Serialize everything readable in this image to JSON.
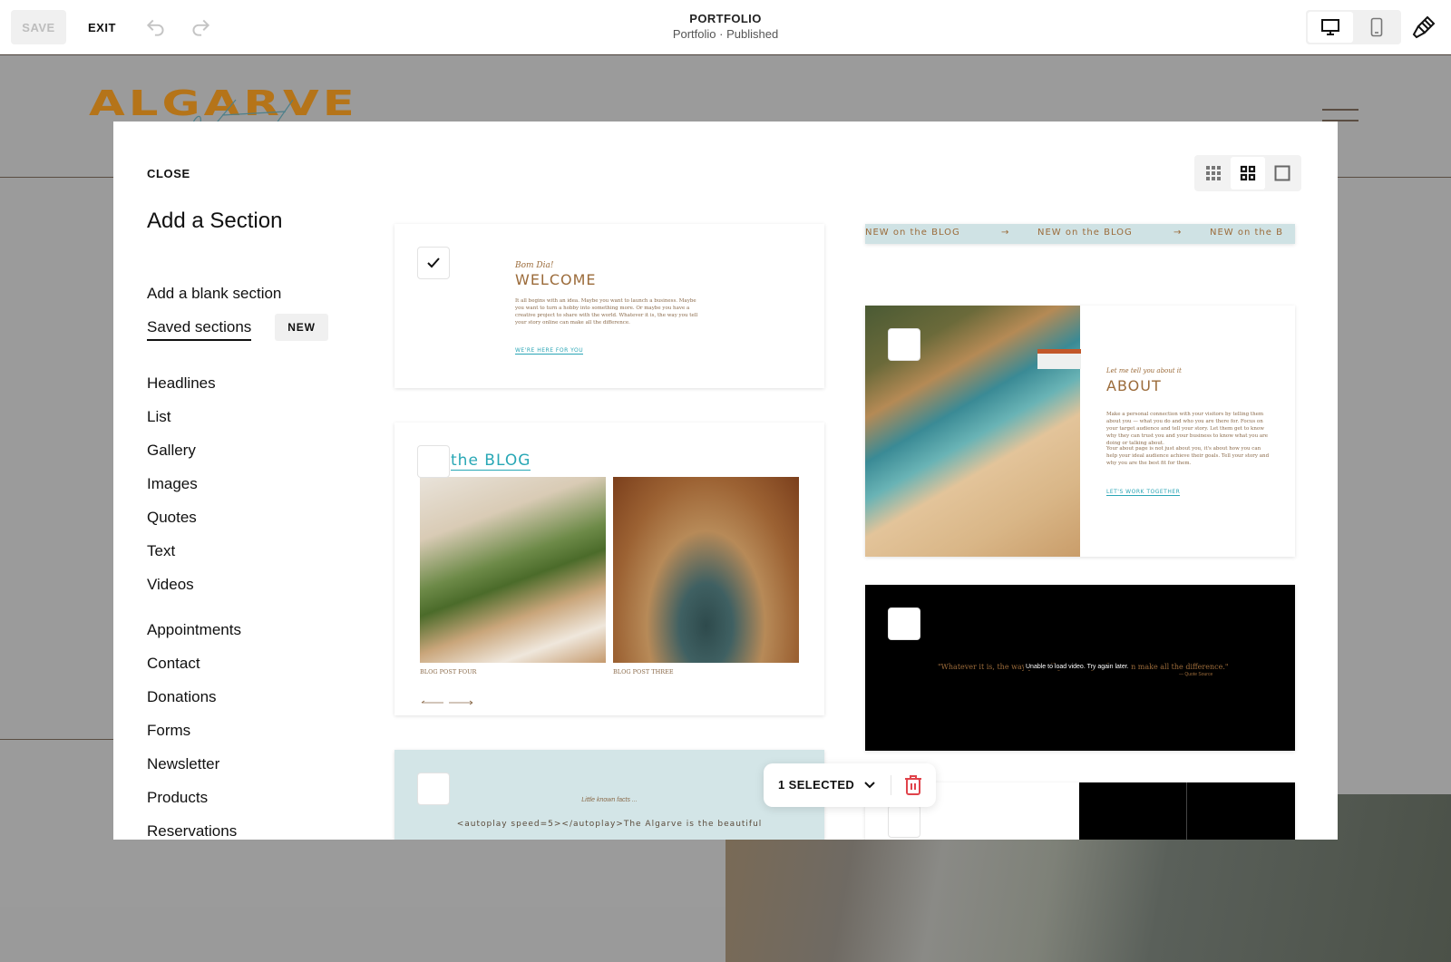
{
  "topbar": {
    "save_label": "SAVE",
    "exit_label": "EXIT",
    "undo_icon": "undo-icon",
    "redo_icon": "redo-icon",
    "page_title": "PORTFOLIO",
    "page_subtitle": "Portfolio · Published",
    "device_views": [
      "desktop",
      "mobile"
    ],
    "active_device": "desktop",
    "design_icon": "paintbrush-icon"
  },
  "site": {
    "logo_text": "ALGARVE"
  },
  "panel": {
    "close_label": "CLOSE",
    "title": "Add a Section",
    "blank_section_label": "Add a blank section",
    "saved_sections_label": "Saved sections",
    "saved_badge": "NEW",
    "categories_group1": [
      "Headlines",
      "List",
      "Gallery",
      "Images",
      "Quotes",
      "Text",
      "Videos"
    ],
    "categories_group2": [
      "Appointments",
      "Contact",
      "Donations",
      "Forms",
      "Newsletter",
      "Products",
      "Reservations"
    ],
    "view_modes": [
      "small-grid",
      "medium-grid",
      "single"
    ],
    "active_view": "medium-grid"
  },
  "sections": {
    "welcome": {
      "selected": true,
      "kicker": "Bom Dia!",
      "heading": "WELCOME",
      "body": "It all begins with an idea. Maybe you want to launch a business. Maybe you want to turn a hobby into something more. Or maybe you have a creative project to share with the world. Whatever it is, the way you tell your story online can make all the difference.",
      "cta": "WE'RE HERE FOR YOU"
    },
    "blog": {
      "selected": false,
      "heading": "the BLOG",
      "post1": "BLOG POST FOUR",
      "post2": "BLOG POST THREE"
    },
    "facts": {
      "selected": false,
      "kicker": "Little known facts ...",
      "body": "<autoplay speed=5></autoplay>The Algarve is the beautiful"
    },
    "ticker": {
      "selected": false,
      "items": [
        "NEW on the BLOG",
        "→",
        "NEW on the BLOG",
        "→",
        "NEW on the B"
      ]
    },
    "about": {
      "selected": false,
      "kicker": "Let me tell you about it",
      "heading": "ABOUT",
      "body1": "Make a personal connection with your visitors by telling them about you — what you do and who you are there for. Focus on your target audience and tell your story. Let them get to know why they can trust you and your business to know what you are doing or talking about.",
      "body2": "Your about page is not just about you, it's about how you can help your ideal audience achieve their goals. Tell your story and why you are the best fit for them.",
      "cta": "LET'S WORK TOGETHER"
    },
    "quote_video": {
      "selected": false,
      "quote": "\"Whatever it is, the way you tell your story online can make all the difference.\"",
      "error": "Unable to load video. Try again later.",
      "attribution": "— Quote Source"
    },
    "video_grid": {
      "selected": false
    }
  },
  "selection_bar": {
    "label": "1 SELECTED",
    "chevron_icon": "chevron-down-icon",
    "delete_icon": "trash-icon",
    "delete_color": "#e0434b"
  },
  "colors": {
    "brand_gold": "#b57419",
    "accent_teal": "#28a7b5",
    "text_brown": "#9b6b3a"
  }
}
